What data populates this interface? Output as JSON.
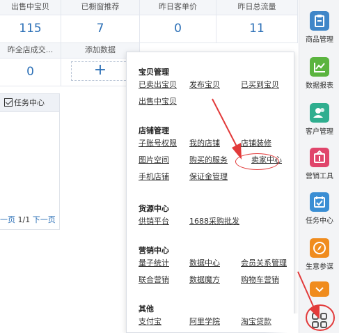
{
  "stats": {
    "row1": [
      {
        "label": "出售中宝贝",
        "value": "115"
      },
      {
        "label": "已橱窗推荐",
        "value": "7"
      },
      {
        "label": "昨日客单价",
        "value": "0"
      },
      {
        "label": "昨日总流量",
        "value": "11"
      }
    ],
    "row2": [
      {
        "label": "昨全店成交...",
        "value": "0"
      },
      {
        "label": "添加数据",
        "value": "+"
      }
    ]
  },
  "task_panel": {
    "title": "任务中心",
    "pager_prev": "一页",
    "pager_pages": "1/1",
    "pager_next": "下一页"
  },
  "menu": {
    "sections": [
      {
        "title": "宝贝管理",
        "rows": [
          [
            "已卖出宝贝",
            "发布宝贝",
            "已买到宝贝"
          ],
          [
            "出售中宝贝"
          ]
        ]
      },
      {
        "title": "店铺管理",
        "rows": [
          [
            "子账号权限",
            "我的店铺",
            "店铺装修"
          ],
          [
            "图片空间",
            "购买的服务",
            "卖家中心"
          ],
          [
            "手机店铺",
            "保证金管理"
          ]
        ]
      },
      {
        "title": "货源中心",
        "rows": [
          [
            "供销平台",
            "1688采购批发"
          ]
        ]
      },
      {
        "title": "营销中心",
        "rows": [
          [
            "量子统计",
            "数据中心",
            "会员关系管理"
          ],
          [
            "联合营销",
            "数据魔方",
            "购物车营销"
          ]
        ]
      },
      {
        "title": "其他",
        "rows": [
          [
            "支付宝",
            "阿里学院",
            "淘宝贷款"
          ]
        ]
      }
    ]
  },
  "sidebar": {
    "items": [
      {
        "label": "商品管理",
        "icon": "product-icon",
        "color": "#3f86c8"
      },
      {
        "label": "数据报表",
        "icon": "chart-icon",
        "color": "#5bb43f"
      },
      {
        "label": "客户管理",
        "icon": "customer-icon",
        "color": "#2fae8f"
      },
      {
        "label": "营销工具",
        "icon": "marketing-icon",
        "color": "#e0456b"
      },
      {
        "label": "任务中心",
        "icon": "task-icon",
        "color": "#3a8ed4"
      },
      {
        "label": "生意参谋",
        "icon": "compass-icon",
        "color": "#f08c1e"
      }
    ],
    "expand_icon": "chevron-down-icon",
    "apps_icon": "grid-icon"
  },
  "colors": {
    "accent": "#2b6fb6",
    "highlight": "#e23a3a"
  }
}
